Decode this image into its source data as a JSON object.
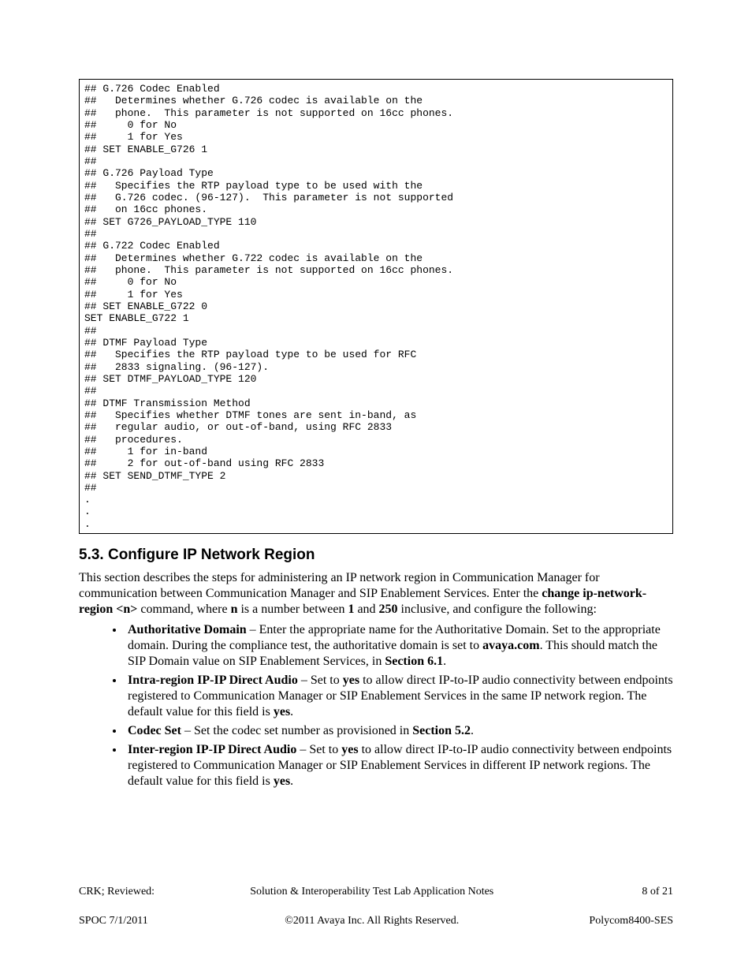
{
  "code_block": "## G.726 Codec Enabled\n##   Determines whether G.726 codec is available on the\n##   phone.  This parameter is not supported on 16cc phones.\n##     0 for No\n##     1 for Yes\n## SET ENABLE_G726 1\n##\n## G.726 Payload Type\n##   Specifies the RTP payload type to be used with the\n##   G.726 codec. (96-127).  This parameter is not supported\n##   on 16cc phones.\n## SET G726_PAYLOAD_TYPE 110\n##\n## G.722 Codec Enabled\n##   Determines whether G.722 codec is available on the\n##   phone.  This parameter is not supported on 16cc phones.\n##     0 for No\n##     1 for Yes\n## SET ENABLE_G722 0\nSET ENABLE_G722 1\n##\n## DTMF Payload Type\n##   Specifies the RTP payload type to be used for RFC\n##   2833 signaling. (96-127).\n## SET DTMF_PAYLOAD_TYPE 120\n##\n## DTMF Transmission Method\n##   Specifies whether DTMF tones are sent in-band, as\n##   regular audio, or out-of-band, using RFC 2833\n##   procedures.\n##     1 for in-band\n##     2 for out-of-band using RFC 2833\n## SET SEND_DTMF_TYPE 2\n##\n.\n.\n.",
  "section": {
    "number": "5.3.",
    "title": "Configure IP Network Region"
  },
  "intro": {
    "p1a": "This section describes the steps for administering an IP network region in Communication Manager for communication between Communication Manager and SIP Enablement Services.  Enter the ",
    "cmd": "change ip-network-region <n>",
    "p1b": " command, where ",
    "nbold": "n",
    "p1c": " is a number between ",
    "one": "1",
    "p1d": " and ",
    "twofifty": "250",
    "p1e": " inclusive, and configure the following:"
  },
  "bullets": {
    "b1": {
      "label": "Authoritative Domain",
      "t1": " – Enter the appropriate name for the Authoritative Domain.  Set to the appropriate domain.  During the compliance test, the authoritative domain is set to ",
      "domain": "avaya.com",
      "t2": ". This should match the SIP Domain value on SIP Enablement Services, in ",
      "sec": "Section 6.1",
      "t3": "."
    },
    "b2": {
      "label": "Intra-region IP-IP Direct Audio",
      "t1": " – Set to ",
      "yes1": "yes",
      "t2": " to allow direct IP-to-IP audio connectivity between endpoints registered to Communication Manager or SIP Enablement Services in the same IP network region. The default value for this field is ",
      "yes2": "yes",
      "t3": "."
    },
    "b3": {
      "label": "Codec Set",
      "t1": " – Set the codec set number as provisioned in ",
      "sec": "Section 5.2",
      "t2": "."
    },
    "b4": {
      "label": "Inter-region IP-IP Direct Audio",
      "t1": " – Set to ",
      "yes1": "yes",
      "t2": " to allow direct IP-to-IP audio connectivity between endpoints registered to Communication Manager or SIP Enablement Services in different IP network regions.  The default value for this field is ",
      "yes2": "yes",
      "t3": "."
    }
  },
  "footer": {
    "left_line1": "CRK; Reviewed:",
    "left_line2": "SPOC 7/1/2011",
    "center_line1": "Solution & Interoperability Test Lab Application Notes",
    "center_line2": "©2011 Avaya Inc. All Rights Reserved.",
    "right_line1": "8 of 21",
    "right_line2": "Polycom8400-SES"
  }
}
